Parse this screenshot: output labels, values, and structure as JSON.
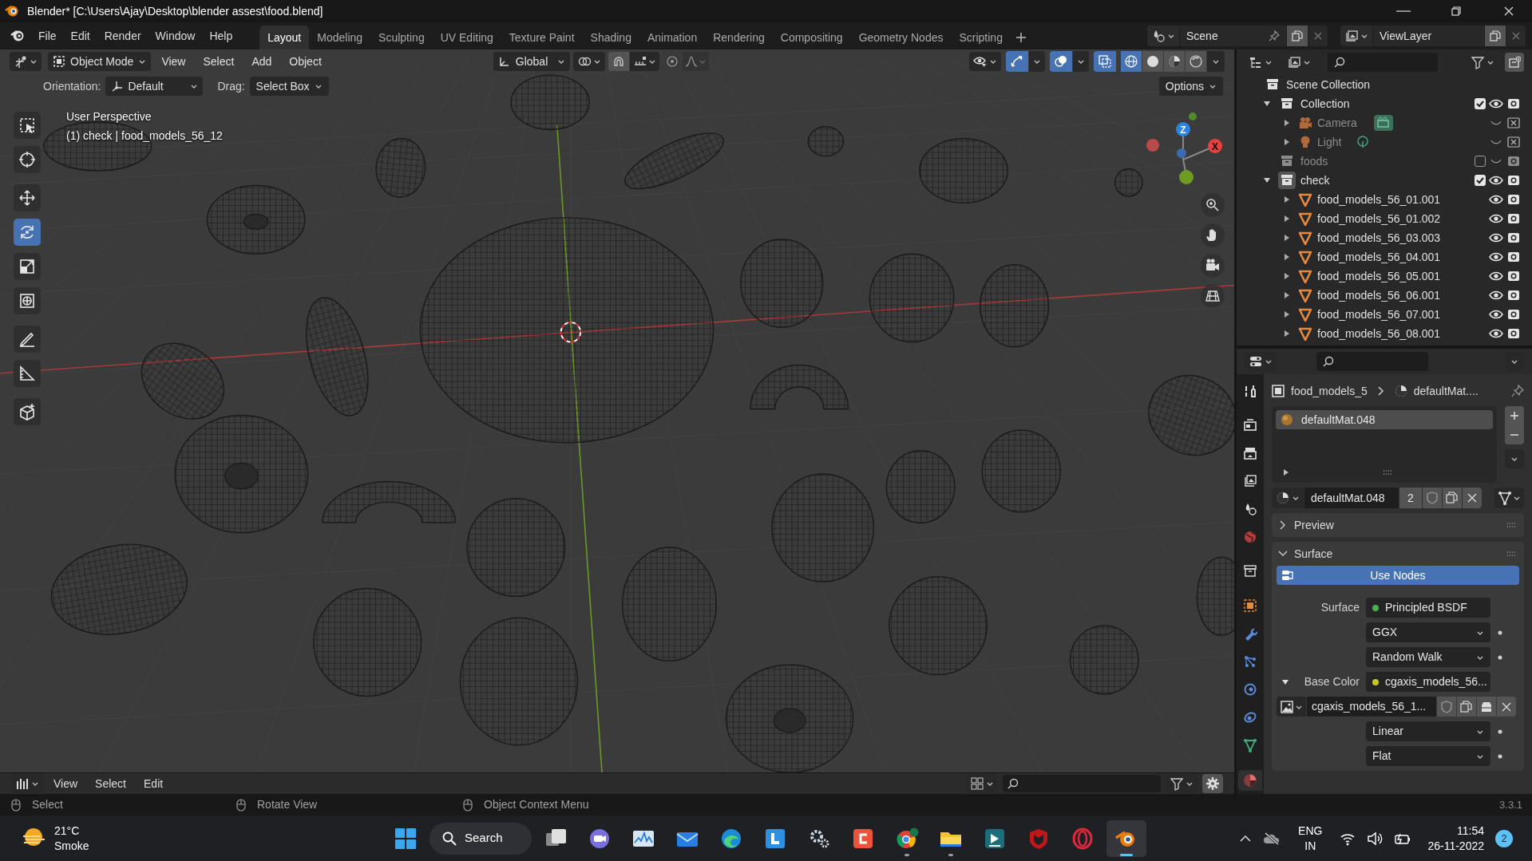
{
  "window": {
    "title": "Blender* [C:\\Users\\Ajay\\Desktop\\blender assest\\food.blend]"
  },
  "menus": [
    "File",
    "Edit",
    "Render",
    "Window",
    "Help"
  ],
  "workspaces": [
    {
      "label": "Layout",
      "selected": true
    },
    {
      "label": "Modeling",
      "selected": false
    },
    {
      "label": "Sculpting",
      "selected": false
    },
    {
      "label": "UV Editing",
      "selected": false
    },
    {
      "label": "Texture Paint",
      "selected": false
    },
    {
      "label": "Shading",
      "selected": false
    },
    {
      "label": "Animation",
      "selected": false
    },
    {
      "label": "Rendering",
      "selected": false
    },
    {
      "label": "Compositing",
      "selected": false
    },
    {
      "label": "Geometry Nodes",
      "selected": false
    },
    {
      "label": "Scripting",
      "selected": false
    }
  ],
  "scene": "Scene",
  "view_layer": "ViewLayer",
  "viewport_header": {
    "mode": "Object Mode",
    "menus": [
      "View",
      "Select",
      "Add",
      "Object"
    ],
    "orientation": "Global",
    "snap": true,
    "toggles": [
      {
        "kind": "gizmos",
        "on": true
      },
      {
        "kind": "overlays",
        "on": true
      },
      {
        "kind": "xray",
        "on": true
      }
    ],
    "shading": [
      {
        "kind": "wireframe",
        "selected": true
      },
      {
        "kind": "solid",
        "selected": false
      },
      {
        "kind": "material",
        "selected": false
      },
      {
        "kind": "rendered",
        "selected": false
      }
    ]
  },
  "tool_settings": {
    "orientation_label": "Orientation:",
    "orientation": "Default",
    "drag_label": "Drag:",
    "drag": "Select Box",
    "options": "Options"
  },
  "viewport": {
    "perspective": "User Perspective",
    "active": "(1) check | food_models_56_12",
    "gizmo": [
      "Z",
      "X"
    ]
  },
  "tools": [
    {
      "kind": "select",
      "selected": false
    },
    {
      "kind": "cursor",
      "selected": false
    },
    {
      "kind": "move",
      "selected": false
    },
    {
      "kind": "rotate",
      "selected": true
    },
    {
      "kind": "scale",
      "selected": false
    },
    {
      "kind": "transform",
      "selected": false
    },
    {
      "kind": "annotate",
      "selected": false
    },
    {
      "kind": "measure",
      "selected": false
    },
    {
      "kind": "add_cube",
      "selected": false
    }
  ],
  "outliner": {
    "root": "Scene Collection",
    "items": [
      {
        "label": "Collection",
        "kind": "collection",
        "expanded": true,
        "checked": true,
        "active": false,
        "hidden": false,
        "renderable": true,
        "children": [
          {
            "label": "Camera",
            "kind": "camera",
            "expanded": false,
            "hidden": true,
            "renderable": false
          },
          {
            "label": "Light",
            "kind": "light",
            "expanded": false,
            "hidden": true,
            "renderable": false
          }
        ]
      },
      {
        "label": "foods",
        "kind": "collection",
        "checked": false,
        "active": false,
        "hidden": true,
        "renderable": true
      },
      {
        "label": "check",
        "kind": "collection",
        "expanded": true,
        "checked": true,
        "active": true,
        "hidden": false,
        "renderable": true,
        "children": [
          {
            "label": "food_models_56_01.001",
            "kind": "mesh",
            "expanded": false,
            "hidden": false,
            "renderable": true
          },
          {
            "label": "food_models_56_01.002",
            "kind": "mesh",
            "expanded": false,
            "hidden": false,
            "renderable": true
          },
          {
            "label": "food_models_56_03.003",
            "kind": "mesh",
            "expanded": false,
            "hidden": false,
            "renderable": true
          },
          {
            "label": "food_models_56_04.001",
            "kind": "mesh",
            "expanded": false,
            "hidden": false,
            "renderable": true
          },
          {
            "label": "food_models_56_05.001",
            "kind": "mesh",
            "expanded": false,
            "hidden": false,
            "renderable": true
          },
          {
            "label": "food_models_56_06.001",
            "kind": "mesh",
            "expanded": false,
            "hidden": false,
            "renderable": true
          },
          {
            "label": "food_models_56_07.001",
            "kind": "mesh",
            "expanded": false,
            "hidden": false,
            "renderable": true
          },
          {
            "label": "food_models_56_08.001",
            "kind": "mesh",
            "expanded": false,
            "hidden": false,
            "renderable": true
          }
        ]
      }
    ]
  },
  "properties": {
    "tabs": [
      {
        "kind": "tool",
        "selected": false
      },
      {
        "kind": "render",
        "selected": false
      },
      {
        "kind": "output",
        "selected": false
      },
      {
        "kind": "view_layer",
        "selected": false
      },
      {
        "kind": "scene",
        "selected": false
      },
      {
        "kind": "world",
        "selected": false
      },
      {
        "kind": "collection",
        "selected": false
      },
      {
        "kind": "object",
        "selected": false
      },
      {
        "kind": "modifiers",
        "selected": false
      },
      {
        "kind": "particles",
        "selected": false
      },
      {
        "kind": "physics",
        "selected": false
      },
      {
        "kind": "constraints",
        "selected": false
      },
      {
        "kind": "data",
        "selected": false
      },
      {
        "kind": "material",
        "selected": true
      }
    ],
    "breadcrumb": [
      "food_models_5",
      "defaultMat...."
    ],
    "slots": [
      {
        "label": "defaultMat.048",
        "selected": true
      }
    ],
    "material": "defaultMat.048",
    "users": "2",
    "panels": [
      {
        "label": "Preview",
        "expanded": false
      },
      {
        "label": "Surface",
        "expanded": true
      }
    ],
    "use_nodes": "Use Nodes",
    "rows": [
      {
        "kind": "link",
        "label": "Surface",
        "value": "Principled BSDF",
        "color": "#4caf50"
      },
      {
        "kind": "dropdown",
        "value": "GGX"
      },
      {
        "kind": "dropdown",
        "value": "Random Walk"
      },
      {
        "kind": "link",
        "label": "Base Color",
        "value": "cgaxis_models_56...",
        "color": "#c7c729",
        "expanded": true
      },
      {
        "kind": "image",
        "value": "cgaxis_models_56_1..."
      },
      {
        "kind": "dropdown",
        "value": "Linear"
      },
      {
        "kind": "dropdown",
        "value": "Flat"
      }
    ]
  },
  "timeline": {
    "menus": [
      "View",
      "Select",
      "Edit"
    ]
  },
  "status_bar": {
    "hints": [
      "Select",
      "Rotate View",
      "Object Context Menu"
    ],
    "version": "3.3.1"
  },
  "taskbar": {
    "temperature": "21°C",
    "weather": "Smoke",
    "search": "Search",
    "apps": [
      {
        "kind": "task_view",
        "active": false,
        "running": false
      },
      {
        "kind": "chat",
        "active": false,
        "running": false
      },
      {
        "kind": "monitor",
        "active": false,
        "running": false
      },
      {
        "kind": "mail",
        "active": false,
        "running": false
      },
      {
        "kind": "browser_edge",
        "active": false,
        "running": false
      },
      {
        "kind": "l_app",
        "active": false,
        "running": false
      },
      {
        "kind": "settings",
        "active": false,
        "running": false
      },
      {
        "kind": "c_app",
        "active": false,
        "running": false
      },
      {
        "kind": "browser_chrome",
        "active": false,
        "running": true
      },
      {
        "kind": "files",
        "active": false,
        "running": true
      },
      {
        "kind": "video_editor",
        "active": false,
        "running": false
      },
      {
        "kind": "shield",
        "active": false,
        "running": false
      },
      {
        "kind": "browser_opera",
        "active": false,
        "running": false
      },
      {
        "kind": "blender",
        "active": true,
        "running": true
      }
    ],
    "language": [
      "ENG",
      "IN"
    ],
    "time": "11:54",
    "date": "26-11-2022",
    "notifications": "2"
  }
}
